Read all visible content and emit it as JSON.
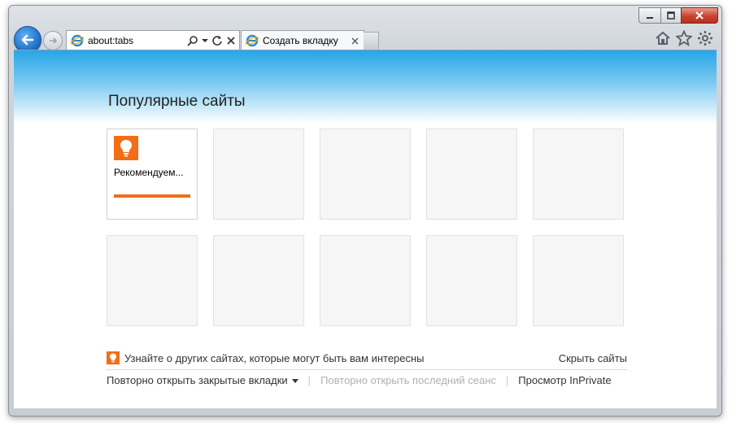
{
  "browser": {
    "address": "about:tabs",
    "tab_title": "Создать вкладку"
  },
  "page": {
    "title": "Популярные сайты",
    "tiles": [
      {
        "label": "Рекомендуем...",
        "has_content": true
      },
      {
        "label": "",
        "has_content": false
      },
      {
        "label": "",
        "has_content": false
      },
      {
        "label": "",
        "has_content": false
      },
      {
        "label": "",
        "has_content": false
      },
      {
        "label": "",
        "has_content": false
      },
      {
        "label": "",
        "has_content": false
      },
      {
        "label": "",
        "has_content": false
      },
      {
        "label": "",
        "has_content": false
      },
      {
        "label": "",
        "has_content": false
      }
    ],
    "discover_text": "Узнайте о других сайтах, которые могут быть вам интересны",
    "hide_sites": "Скрыть сайты",
    "reopen_tabs": "Повторно открыть закрытые вкладки",
    "reopen_session": "Повторно открыть последний сеанс",
    "inprivate": "Просмотр InPrivate",
    "separator": "|"
  },
  "colors": {
    "accent": "#f26d16",
    "banner": "#27a6e8"
  }
}
